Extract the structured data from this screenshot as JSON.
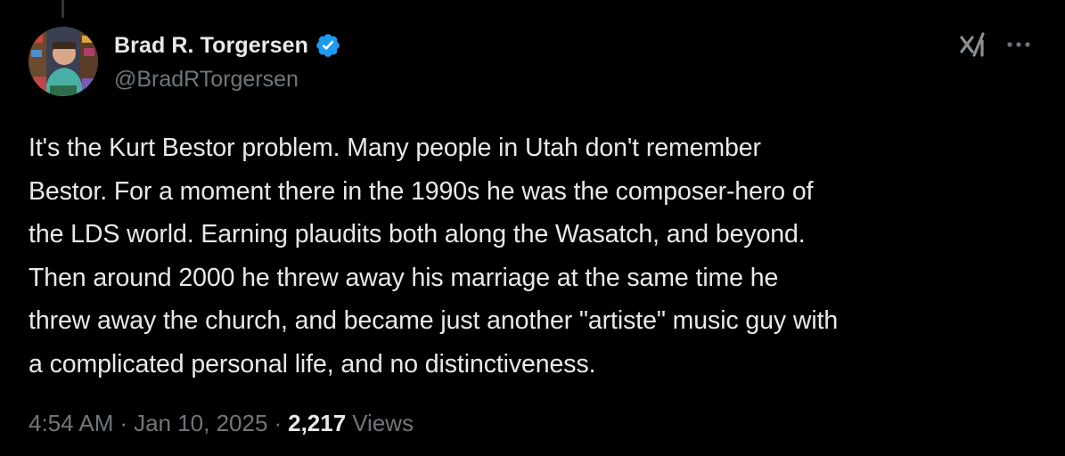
{
  "author": {
    "display_name": "Brad R. Torgersen",
    "handle": "@BradRTorgersen",
    "verified": true
  },
  "icons": {
    "verified": "verified-badge-icon",
    "grok": "grok-icon",
    "more": "more-options-icon"
  },
  "tweet": {
    "text": "It's the Kurt Bestor problem. Many people in Utah don't remember\nBestor. For a moment there in the 1990s he was the composer-hero of\nthe LDS world. Earning plaudits both along the Wasatch, and beyond.\nThen around 2000 he threw away his marriage at the same time he\nthrew away the church, and became just another \"artiste\" music guy with\na complicated personal life, and no distinctiveness."
  },
  "meta": {
    "time": "4:54 AM",
    "separator": "·",
    "date": "Jan 10, 2025",
    "views_count": "2,217",
    "views_label": "Views"
  },
  "colors": {
    "background": "#000000",
    "primary_text": "#e7e9ea",
    "secondary_text": "#71767b",
    "verified_blue": "#1d9bf0"
  }
}
